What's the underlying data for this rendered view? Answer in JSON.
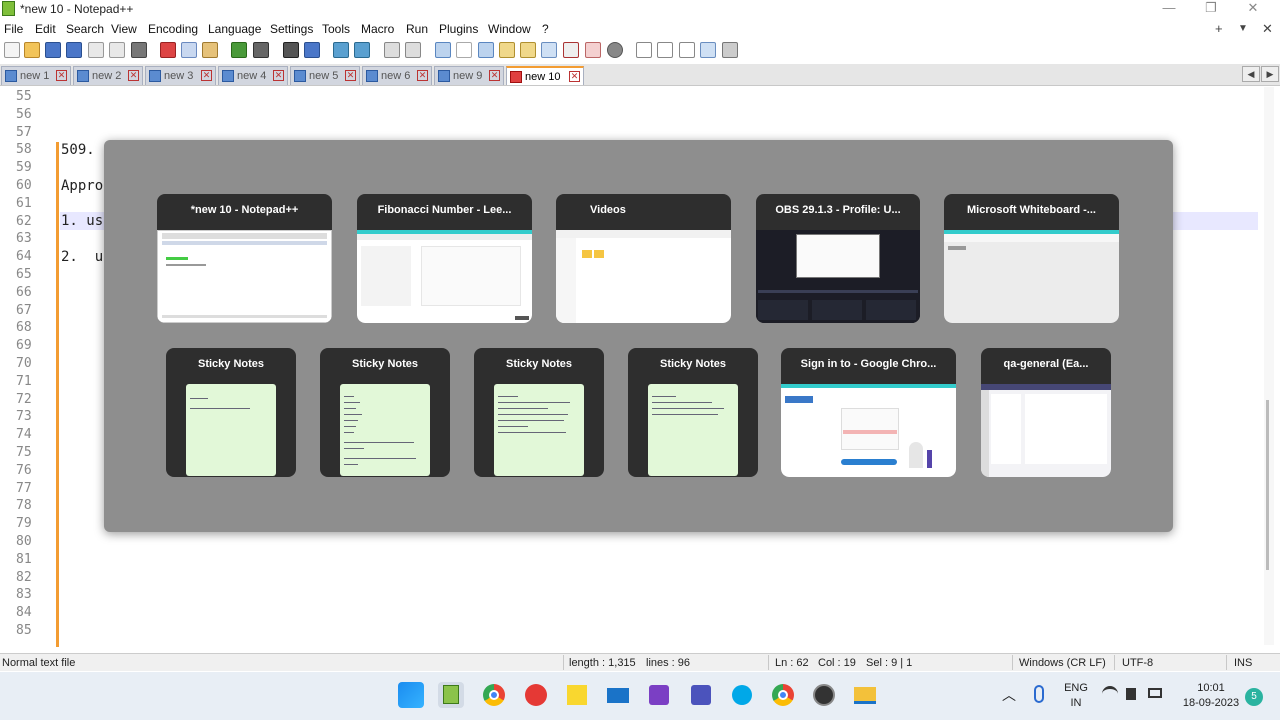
{
  "window": {
    "title": "*new 10 - Notepad++",
    "min": "—",
    "restore": "❐",
    "close": "✕"
  },
  "menu": {
    "items": [
      "File",
      "Edit",
      "Search",
      "View",
      "Encoding",
      "Language",
      "Settings",
      "Tools",
      "Macro",
      "Run",
      "Plugins",
      "Window",
      "?"
    ],
    "plus": "+",
    "dropdown": "▼",
    "close": "✕"
  },
  "tabs": [
    {
      "label": "new 1",
      "active": false
    },
    {
      "label": "new 2",
      "active": false
    },
    {
      "label": "new 3",
      "active": false
    },
    {
      "label": "new 4",
      "active": false
    },
    {
      "label": "new 5",
      "active": false
    },
    {
      "label": "new 6",
      "active": false
    },
    {
      "label": "new 9",
      "active": false
    },
    {
      "label": "new 10",
      "active": true
    }
  ],
  "tabnav": {
    "left": "◀",
    "right": "▶"
  },
  "tab_close": "✕",
  "editor": {
    "line_numbers": [
      "55",
      "56",
      "57",
      "58",
      "59",
      "60",
      "61",
      "62",
      "63",
      "64",
      "65",
      "66",
      "67",
      "68",
      "69",
      "70",
      "71",
      "72",
      "73",
      "74",
      "75",
      "76",
      "77",
      "78",
      "79",
      "80",
      "81",
      "82",
      "83",
      "84",
      "85"
    ],
    "code": {
      "line58": "509.",
      "line60": "Appro",
      "line62": "1. us",
      "line64": "2.  u"
    }
  },
  "switcher": {
    "row1": [
      {
        "title": "*new 10 - Notepad++"
      },
      {
        "title": "Fibonacci Number - Lee..."
      },
      {
        "title": "Videos"
      },
      {
        "title": "OBS 29.1.3 - Profile: U..."
      },
      {
        "title": "Microsoft Whiteboard -..."
      }
    ],
    "row2": [
      {
        "title": "Sticky Notes"
      },
      {
        "title": "Sticky Notes"
      },
      {
        "title": "Sticky Notes"
      },
      {
        "title": "Sticky Notes"
      },
      {
        "title": "Sign in to - Google Chro..."
      },
      {
        "title": "qa-general (Ea..."
      }
    ]
  },
  "status": {
    "file_type": "Normal text file",
    "length": "length : 1,315",
    "lines": "lines : 96",
    "ln": "Ln : 62",
    "col": "Col : 19",
    "sel": "Sel : 9 | 1",
    "eol": "Windows (CR LF)",
    "encoding": "UTF-8",
    "mode": "INS"
  },
  "taskbar": {
    "icons": [
      "windows-start-icon",
      "notepadpp-icon",
      "chrome-icon",
      "anydesk-icon",
      "sticky-notes-icon",
      "mail-icon",
      "visual-studio-icon",
      "teams-icon",
      "skype-icon",
      "chrome-profile-icon",
      "obs-icon",
      "file-explorer-icon"
    ],
    "tray": {
      "chevron": "︿",
      "lang_top": "ENG",
      "lang_bottom": "IN",
      "time": "10:01",
      "date": "18-09-2023",
      "notif": "5"
    }
  },
  "colors": {
    "accent": "#f39c32",
    "switcher_bg": "#8e8e8e",
    "card_bg": "#2e2e2e",
    "sticky_bg": "#e2f8d8"
  }
}
